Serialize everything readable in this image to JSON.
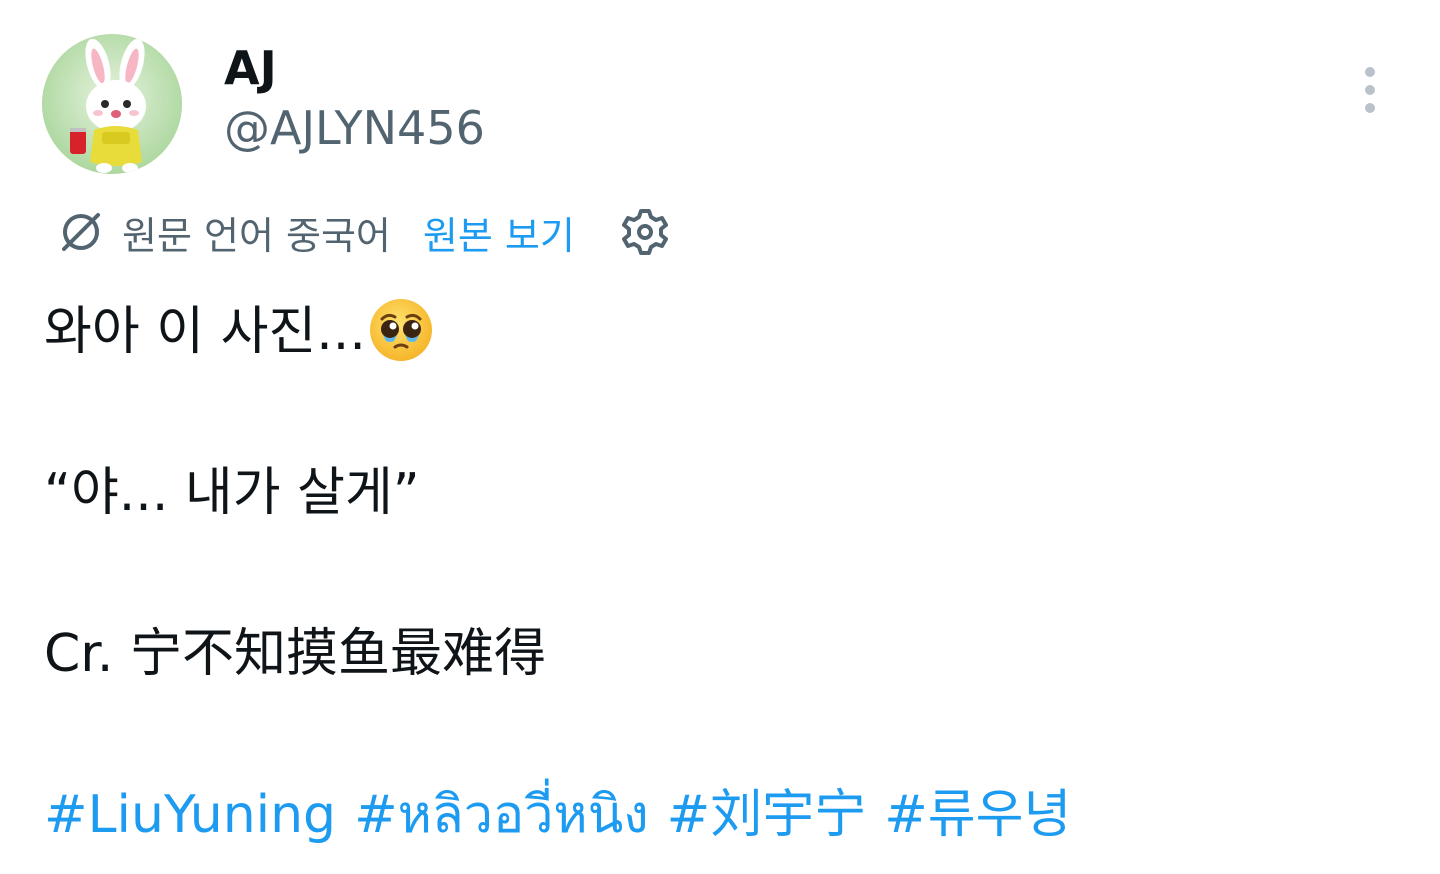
{
  "author": {
    "display_name": "AJ",
    "handle": "@AJLYN456"
  },
  "translation": {
    "label": "원문 언어 중국어",
    "show_original": "원본 보기"
  },
  "tweet": {
    "line1": "와아 이 사진...",
    "line2": "“야... 내가 살게”",
    "line3": "Cr. 宁不知摸鱼最难得",
    "hashtags": [
      "#LiuYuning",
      "#หลิวอวี่หนิง",
      "#刘宇宁",
      "#류우녕"
    ]
  },
  "colors": {
    "link": "#1d9bf0",
    "secondary_text": "#536471",
    "primary_text": "#0f1419"
  },
  "icons": {
    "more": "vertical-ellipsis",
    "translate": "slashed-circle",
    "settings": "gear",
    "emoji": "pleading-face"
  }
}
